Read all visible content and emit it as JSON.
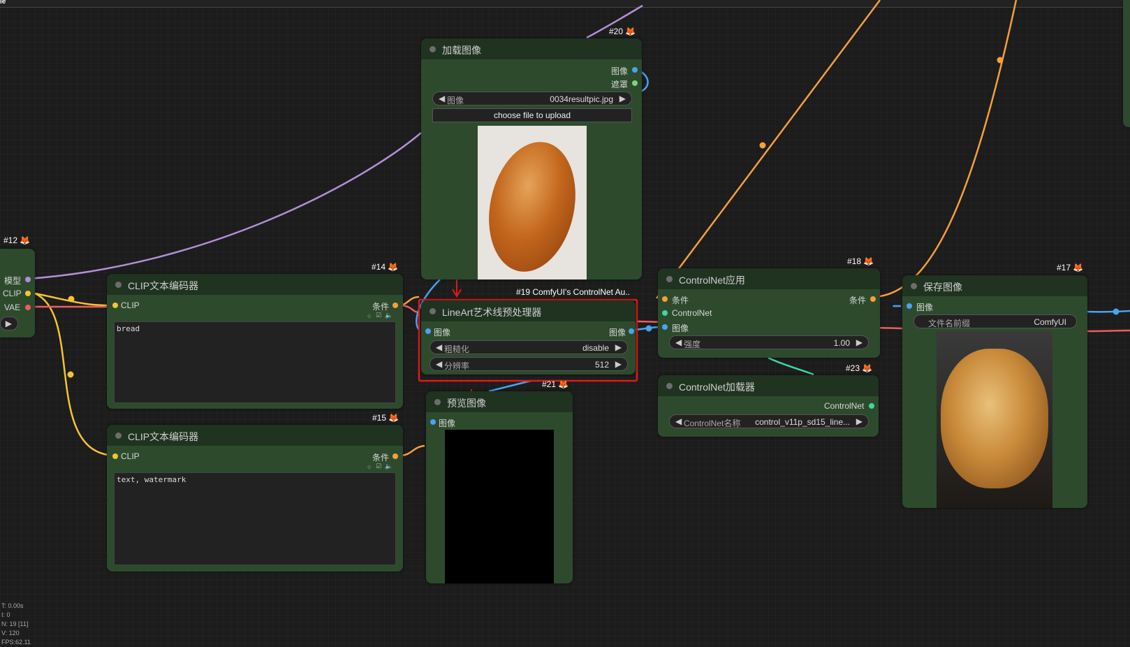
{
  "topbar": {
    "label": "le"
  },
  "nodes": {
    "n12": {
      "badge": "#12",
      "out_model": "模型",
      "out_clip": "CLIP",
      "out_vae": "VAE"
    },
    "n14": {
      "badge": "#14",
      "title": "CLIP文本编码器",
      "in_clip": "CLIP",
      "out_cond": "条件",
      "text": "bread"
    },
    "n15": {
      "badge": "#15",
      "title": "CLIP文本编码器",
      "in_clip": "CLIP",
      "out_cond": "条件",
      "text": "text, watermark"
    },
    "n20": {
      "badge": "#20",
      "title": "加载图像",
      "out_image": "图像",
      "out_mask": "遮罩",
      "image_label": "图像",
      "image_value": "0034resultpic.jpg",
      "upload_label": "choose file to upload"
    },
    "n19": {
      "badge": "#19 ComfyUI's ControlNet Au..",
      "title": "LineArt艺术线预处理器",
      "in_image": "图像",
      "out_image": "图像",
      "coarse_label": "粗糙化",
      "coarse_value": "disable",
      "res_label": "分辨率",
      "res_value": "512"
    },
    "n21": {
      "badge": "#21",
      "title": "预览图像",
      "in_image": "图像"
    },
    "n18": {
      "badge": "#18",
      "title": "ControlNet应用",
      "in_cond": "条件",
      "in_cn": "ControlNet",
      "in_image": "图像",
      "out_cond": "条件",
      "strength_label": "强度",
      "strength_value": "1.00"
    },
    "n23": {
      "badge": "#23",
      "title": "ControlNet加载器",
      "out_cn": "ControlNet",
      "name_label": "ControlNet名称",
      "name_value": "control_v11p_sd15_line..."
    },
    "n17": {
      "badge": "#17",
      "title": "保存图像",
      "in_image": "图像",
      "prefix_label": "文件名前缀",
      "prefix_value": "ComfyUI"
    }
  },
  "stats": {
    "t": "T: 0.00s",
    "i": "I: 0",
    "n": "N: 19 [11]",
    "v": "V: 120",
    "fps": "FPS:62.11"
  },
  "colors": {
    "background": "#1c1c1c",
    "node_body": "#2d4a2d",
    "node_header": "#1f3320",
    "link_model": "#b28fd8",
    "link_clip": "#f5c431",
    "link_vae": "#ee5c5c",
    "link_conditioning": "#f5a03c",
    "link_image": "#4aa3f0",
    "link_controlnet": "#3fd6a0",
    "highlight": "#e01a1a"
  },
  "icons": [
    "fox-icon",
    "arrow-left-icon",
    "arrow-right-icon",
    "circle-toggle-icon",
    "checkbox-icon",
    "speaker-icon"
  ]
}
